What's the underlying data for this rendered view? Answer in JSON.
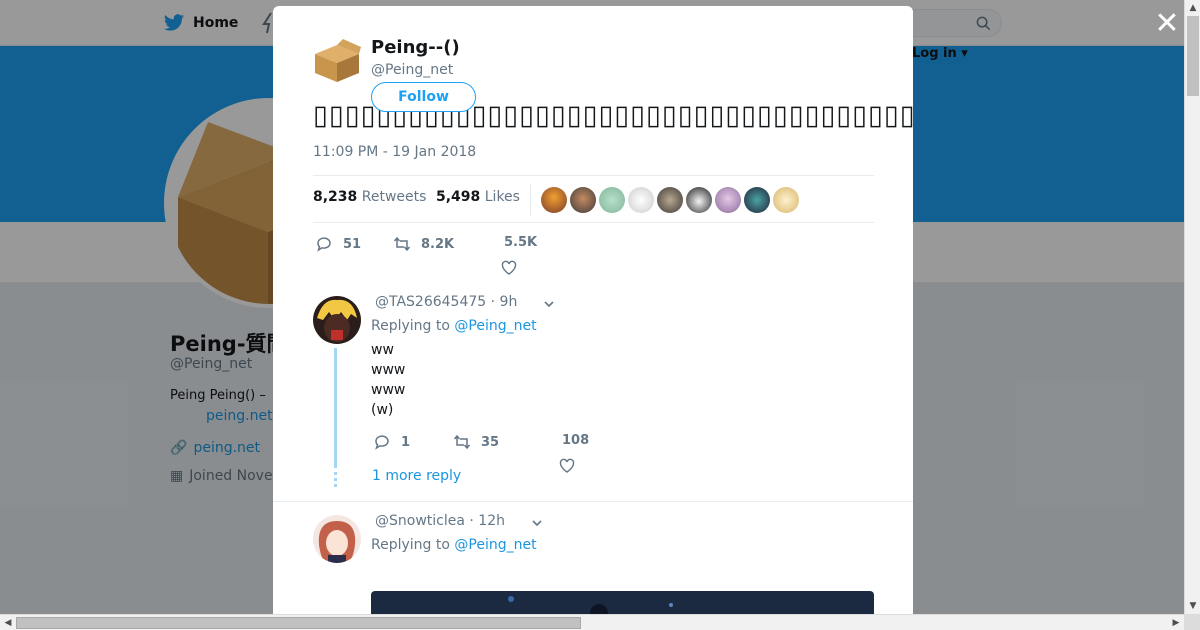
{
  "topbar": {
    "home_label": "Home",
    "login_label": "Log in ▾"
  },
  "profile": {
    "name": "Peing-質問箱",
    "handle": "@Peing_net",
    "bio": "Peing Peing() –",
    "bio_link": "peing.net",
    "url": "peing.net",
    "joined": "Joined November"
  },
  "tweet": {
    "name": "Peing--()",
    "handle": "@Peing_net",
    "follow_label": "Follow",
    "text": "▯▯▯▯▯▯▯▯▯▯▯▯▯▯▯▯▯▯▯▯▯▯▯▯▯▯▯▯▯▯▯▯▯▯▯▯▯▯▯▯▯▯▯▯▯▯▯▯▯▯▯",
    "time": "11:09 PM - 19 Jan 2018",
    "retweets_count": "8,238",
    "retweets_label": "Retweets",
    "likes_count": "5,498",
    "likes_label": "Likes",
    "reply_count": "51",
    "retweet_count_short": "8.2K",
    "like_count_short": "5.5K"
  },
  "replies": [
    {
      "handle": "@TAS26645475",
      "time": "· 9h",
      "replying_prefix": "Replying to",
      "replying_to": "@Peing_net",
      "lines": [
        "ww",
        "www",
        "www",
        "(w)"
      ],
      "reply_count": "1",
      "retweet_count": "35",
      "like_count": "108",
      "more_label": "1 more reply"
    },
    {
      "handle": "@Snowticlea",
      "time": "· 12h",
      "replying_prefix": "Replying to",
      "replying_to": "@Peing_net"
    }
  ],
  "colors": {
    "accent": "#1da1f2",
    "banner": "#1da1f2",
    "link": "#1b95e0",
    "muted": "#657786"
  }
}
